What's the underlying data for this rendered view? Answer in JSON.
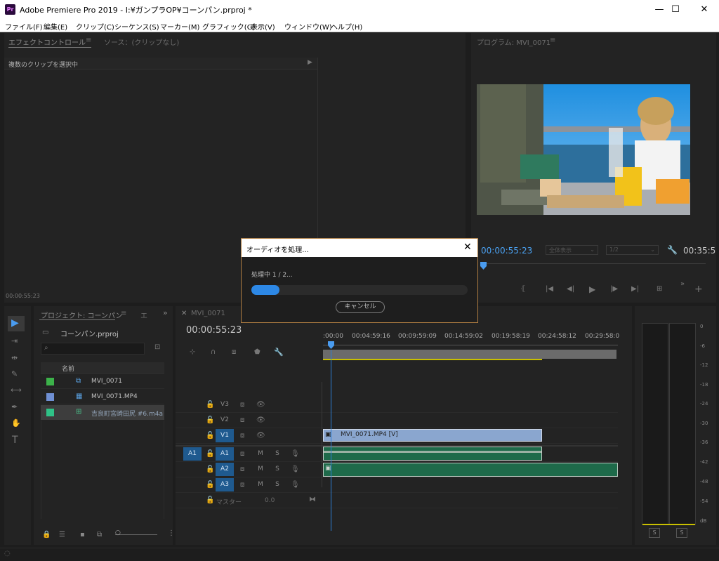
{
  "window": {
    "app_icon": "Pr",
    "title": "Adobe Premiere Pro 2019 - I:¥ガンプラOP¥コーンパン.prproj *",
    "minimize": "—",
    "maximize": "☐",
    "close": "✕"
  },
  "menu": [
    "ファイル(F)",
    "編集(E)",
    "クリップ(C)",
    "シーケンス(S)",
    "マーカー(M)",
    "グラフィック(G)",
    "表示(V)",
    "ウィンドウ(W)",
    "ヘルプ(H)"
  ],
  "effect_panel": {
    "tab_effect": "エフェクトコントロール",
    "tab_source": "ソース：(クリップなし)",
    "header": "複数のクリップを選択中",
    "timecode": "00:00:55:23"
  },
  "program_panel": {
    "tab": "プログラム: MVI_0071",
    "timecode": "00:00:55:23",
    "fit": "全体表示",
    "resolution": "1/2",
    "duration": "00:35:5"
  },
  "project_panel": {
    "tab": "プロジェクト: コーンパン",
    "tab_more": "エ",
    "project_file": "コーンパン.prproj",
    "column_name": "名前",
    "items": [
      {
        "name": "MVI_0071",
        "color": "#3cb24a"
      },
      {
        "name": "MVI_0071.MP4",
        "color": "#6f8fd3"
      },
      {
        "name": "吉良町宮崎田尻 #6.m4a",
        "color": "#2fc287"
      }
    ]
  },
  "timeline": {
    "tab": "MVI_0071",
    "timecode": "00:00:55:23",
    "ruler": [
      ":00:00",
      "00:04:59:16",
      "00:09:59:09",
      "00:14:59:02",
      "00:19:58:19",
      "00:24:58:12",
      "00:29:58:0"
    ],
    "tracks": {
      "v3": "V3",
      "v2": "V2",
      "v1": "V1",
      "a1": "A1",
      "a2": "A2",
      "a3": "A3",
      "a1_source": "A1",
      "master": "マスター",
      "master_value": "0.0",
      "m": "M",
      "s": "S"
    },
    "video_clip": "MVI_0071.MP4 [V]"
  },
  "meter": {
    "ticks": [
      "0",
      "-6",
      "-12",
      "-18",
      "-24",
      "-30",
      "-36",
      "-42",
      "-48",
      "-54",
      "dB"
    ],
    "solo_left": "S",
    "solo_right": "S"
  },
  "dialog": {
    "title": "オーディオを処理...",
    "status": "処理中 1 / 2...",
    "progress": 0.13,
    "cancel": "キャンセル",
    "close": "✕"
  },
  "tools": [
    "▶",
    "⇥",
    "⇹",
    "✎",
    "⟷",
    "✒",
    "✋",
    "T"
  ]
}
